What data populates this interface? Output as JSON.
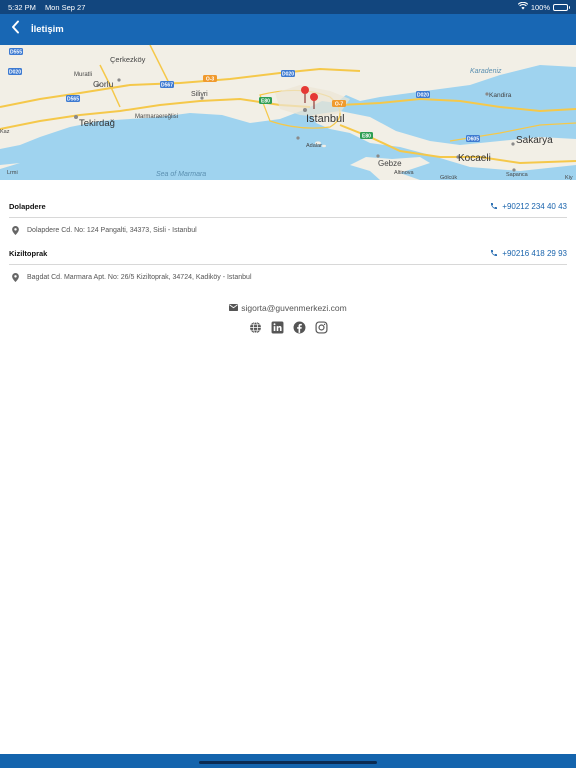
{
  "status_bar": {
    "time": "5:32 PM",
    "date": "Mon Sep 27",
    "battery_text": "100%",
    "battery_level": 1.0
  },
  "nav": {
    "title": "İletişim"
  },
  "map": {
    "cities": [
      "Çerkezköy",
      "Muratli",
      "Corlu",
      "Silivri",
      "Tekirdağ",
      "Marmaraereğlisi",
      "Istanbul",
      "Adalar",
      "Gebze",
      "Kocaeli",
      "Sakarya",
      "Kandira",
      "Altinova",
      "Gölcük",
      "Sapanca",
      "Kiy",
      "Lrmi",
      "Kaz"
    ],
    "seas": [
      "Sea of Marmara",
      "Karadeniz"
    ],
    "road_shields": [
      "D555",
      "D567",
      "O-3",
      "D020",
      "D565",
      "E80",
      "D020",
      "O-7",
      "E80",
      "D605",
      "D020"
    ],
    "pins": 2
  },
  "locations": [
    {
      "name": "Dolapdere",
      "phone": "+90212 234 40 43",
      "address": "Dolapdere Cd. No: 124 Pangalti, 34373, Sisli - Istanbul"
    },
    {
      "name": "Kiziltoprak",
      "phone": "+90216 418 29 93",
      "address": "Bagdat Cd. Marmara Apt. No: 26/5 Kiziltoprak, 34724, Kadiköy - Istanbul"
    }
  ],
  "contact": {
    "email": "sigorta@guvenmerkezi.com"
  },
  "social_icons": [
    "globe-icon",
    "linkedin-icon",
    "facebook-icon",
    "instagram-icon"
  ],
  "colors": {
    "status_bar": "#12467e",
    "nav_bar": "#1867b4",
    "link": "#1a64ad",
    "sea": "#9fd3ef",
    "land": "#f2efe6"
  }
}
